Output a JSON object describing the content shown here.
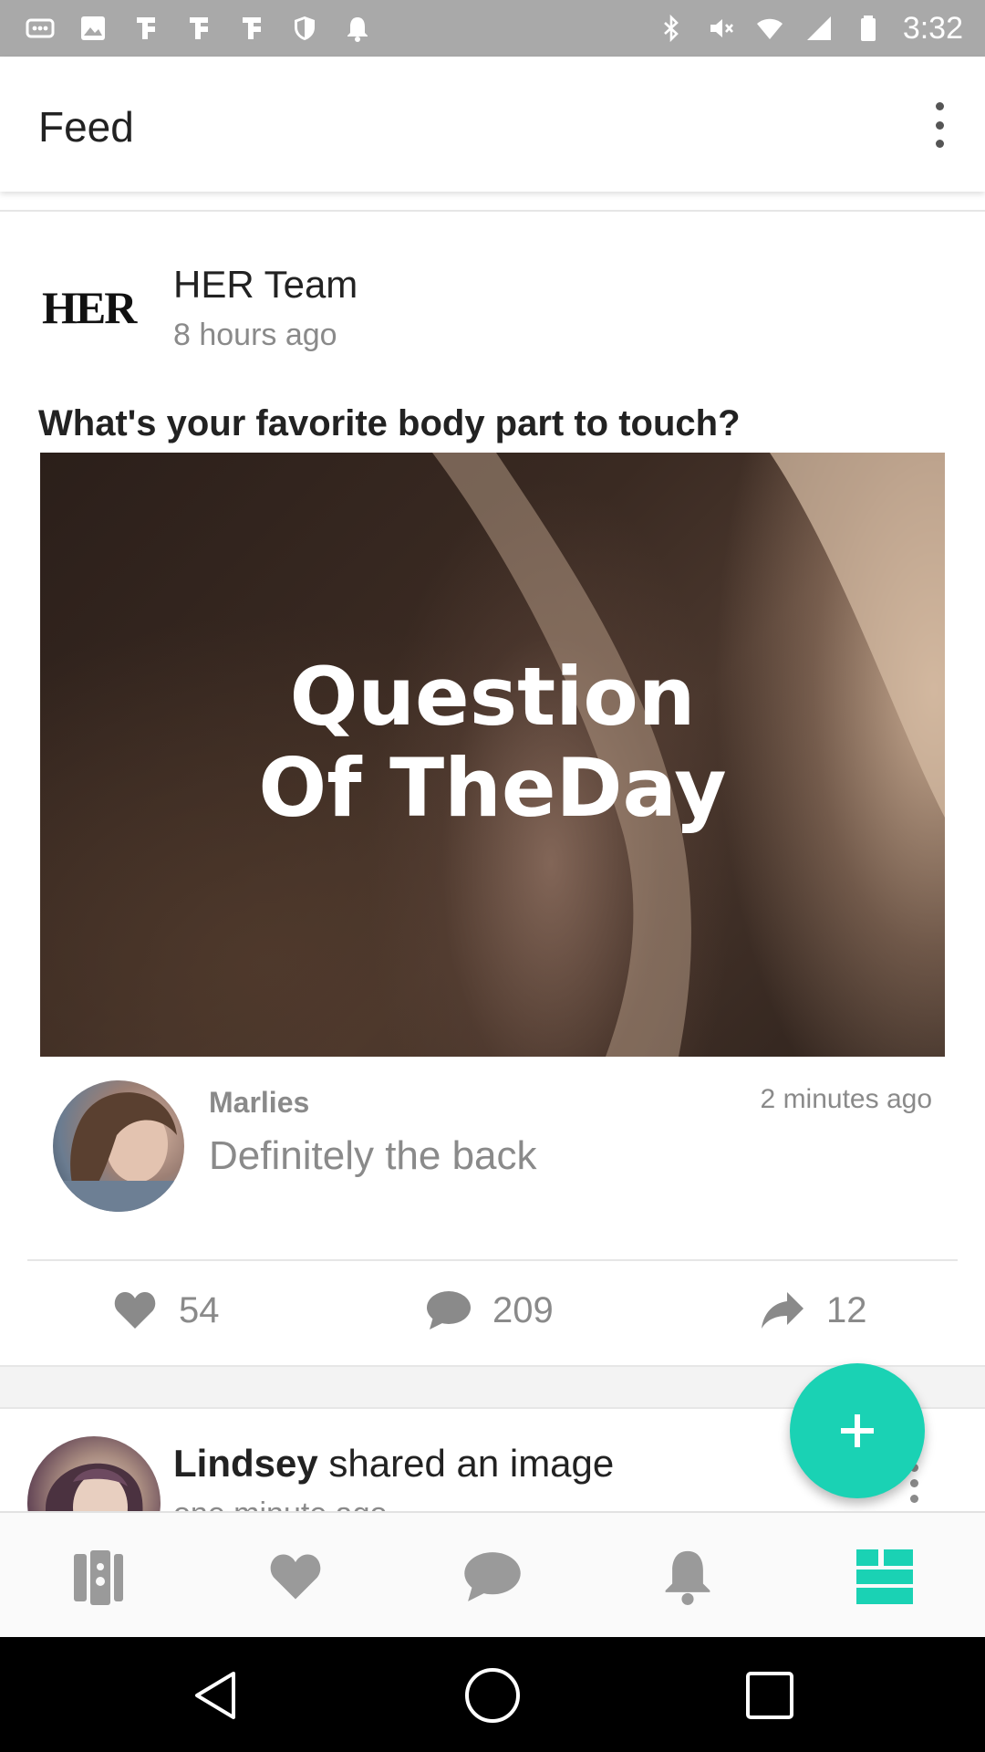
{
  "status_bar": {
    "time": "3:32",
    "left_icons": [
      "more-icon",
      "image-icon",
      "notification-icon",
      "notification-icon",
      "notification-icon",
      "shield-icon",
      "bell-icon"
    ],
    "right_icons": [
      "bluetooth-icon",
      "mute-icon",
      "wifi-icon",
      "signal-icon",
      "battery-icon"
    ]
  },
  "app_bar": {
    "title": "Feed"
  },
  "post": {
    "logo_text": "HER",
    "author": "HER Team",
    "posted": "8 hours ago",
    "question": "What's your favorite body part to touch?",
    "image_caption_line1": "Question",
    "image_caption_line2": "Of TheDay",
    "top_comment": {
      "name": "Marlies",
      "time": "2 minutes ago",
      "text": "Definitely the back"
    },
    "stats": {
      "likes": "54",
      "comments": "209",
      "shares": "12"
    }
  },
  "next_post": {
    "author": "Lindsey",
    "action": " shared an image",
    "subtitle": "one minute ago"
  },
  "fab": {
    "icon": "plus-icon",
    "color": "#1ad2b4"
  },
  "bottom_nav": {
    "items": [
      "cards-icon",
      "heart-icon",
      "chat-icon",
      "bell-icon",
      "feed-icon"
    ],
    "active_index": 4,
    "active_color": "#1ad2b4",
    "inactive_color": "#9a9a9a"
  }
}
